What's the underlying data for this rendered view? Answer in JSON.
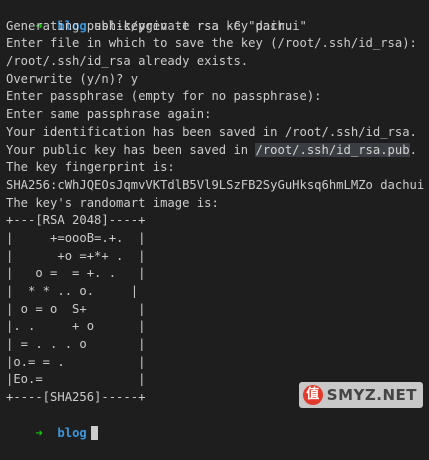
{
  "prompt": {
    "arrow": "➜",
    "dir": "blog",
    "command": "ssh-keygen -t rsa -C \"dachui\""
  },
  "output": [
    "Generating public/private rsa key pair.",
    "Enter file in which to save the key (/root/.ssh/id_rsa):",
    "/root/.ssh/id_rsa already exists.",
    "Overwrite (y/n)? y",
    "Enter passphrase (empty for no passphrase):",
    "Enter same passphrase again:",
    "Your identification has been saved in /root/.ssh/id_rsa.",
    "Your public key has been saved in ",
    "The key fingerprint is:",
    "SHA256:cWhJQEOsJqmvVKTdlB5Vl9LSzFB2SyGuHksq6hmLMZo dachui",
    "The key's randomart image is:"
  ],
  "highlighted_path": "/root/.ssh/id_rsa.pub",
  "after_highlight": ".",
  "randomart": [
    "+---[RSA 2048]----+",
    "|     +=oooB=.+.  |",
    "|      +o =+*+ .  |",
    "|   o =  = +. .   |",
    "|  * * .. o.     |",
    "| o = o  S+       |",
    "|. .     + o      |",
    "| = . . . o       |",
    "|o.= = .          |",
    "|Eo.=             |",
    "+----[SHA256]-----+"
  ],
  "prompt2": {
    "arrow": "➜",
    "dir": "blog"
  },
  "watermark": {
    "logo_char": "值",
    "text": "SMYZ.NET"
  },
  "colors": {
    "background": "#1e1e1e",
    "text": "#cccccc",
    "prompt_arrow": "#16c60c",
    "prompt_dir": "#3a96dd",
    "highlight_bg": "#3a3d41"
  }
}
